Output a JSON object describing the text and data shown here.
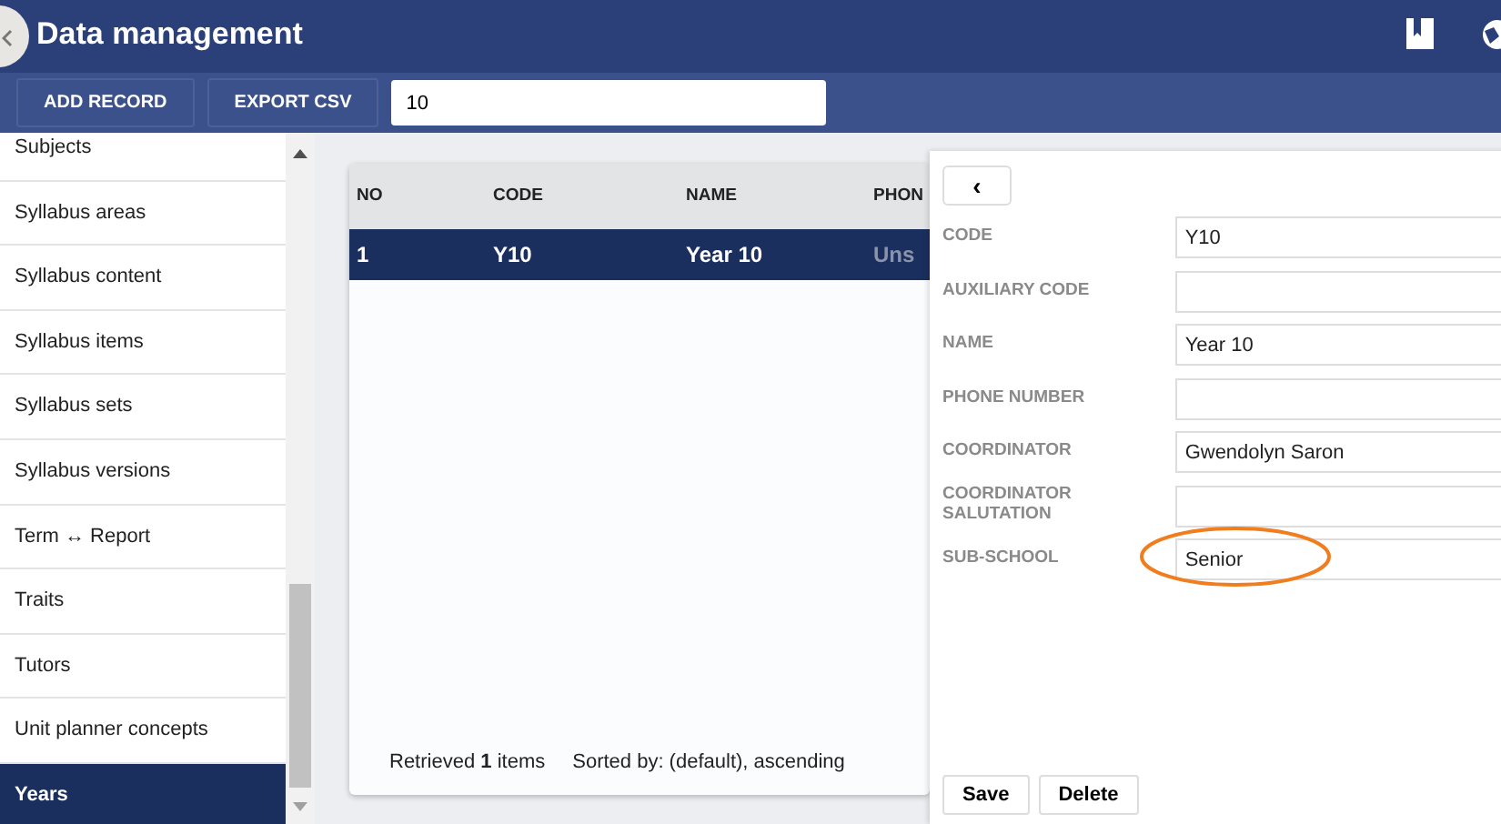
{
  "header": {
    "title": "Data management"
  },
  "toolbar": {
    "buttons": [
      "ADD RECORD",
      "EXPORT CSV"
    ],
    "search_value": "10"
  },
  "sidebar": {
    "items": [
      {
        "label": "Subjects",
        "selected": false
      },
      {
        "label": "Syllabus areas",
        "selected": false
      },
      {
        "label": "Syllabus content",
        "selected": false
      },
      {
        "label": "Syllabus items",
        "selected": false
      },
      {
        "label": "Syllabus sets",
        "selected": false
      },
      {
        "label": "Syllabus versions",
        "selected": false
      },
      {
        "label": "Term ↔ Report",
        "selected": false
      },
      {
        "label": "Traits",
        "selected": false
      },
      {
        "label": "Tutors",
        "selected": false
      },
      {
        "label": "Unit planner concepts",
        "selected": false
      },
      {
        "label": "Years",
        "selected": true
      }
    ]
  },
  "table": {
    "columns": [
      "NO",
      "CODE",
      "NAME",
      "PHON"
    ],
    "rows": [
      {
        "cells": [
          "1",
          "Y10",
          "Year 10",
          "Uns"
        ],
        "selected": true
      }
    ],
    "retrieved": "Retrieved **1** items",
    "sorted": "Sorted by: (default), ascending"
  },
  "detail": {
    "back": "‹",
    "fields": [
      {
        "label": "CODE",
        "value": "Y10",
        "highlighted": false
      },
      {
        "label": "AUXILIARY CODE",
        "highlighted": false
      },
      {
        "label": "NAME",
        "value": "Year 10",
        "highlighted": false
      },
      {
        "label": "PHONE NUMBER",
        "highlighted": false
      },
      {
        "label": "COORDINATOR",
        "value": "Gwendolyn Saron",
        "highlighted": false
      },
      {
        "label": "COORDINATOR SALUTATION",
        "highlighted": false
      },
      {
        "label": "SUB-SCHOOL",
        "value": "Senior",
        "highlighted": true
      }
    ],
    "buttons": [
      "Save",
      "Delete"
    ]
  }
}
